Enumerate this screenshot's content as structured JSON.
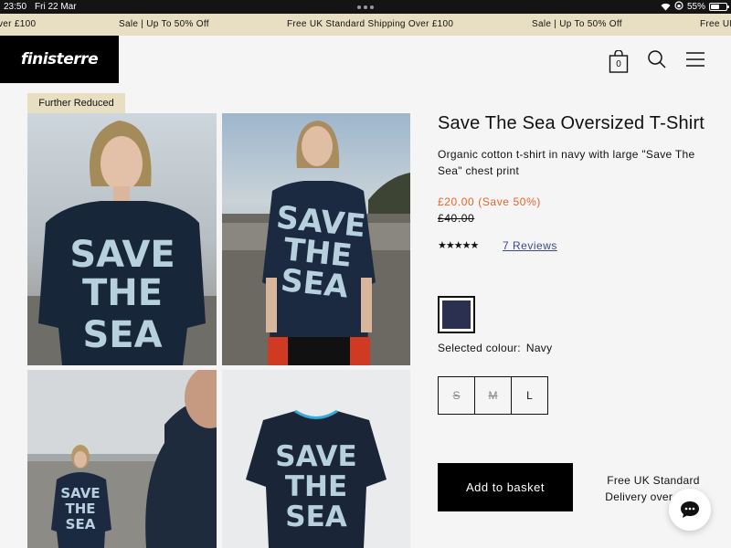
{
  "status_bar": {
    "time": "23:50",
    "date": "Fri 22 Mar",
    "battery": "55%"
  },
  "promo": {
    "items": [
      "ver £100",
      "Sale | Up To 50% Off",
      "Free UK Standard Shipping Over £100",
      "Sale | Up To 50% Off",
      "Free UK"
    ]
  },
  "header": {
    "logo": "finisterre",
    "bag_count": "0",
    "icons": [
      "bag-icon",
      "search-icon",
      "menu-icon"
    ]
  },
  "gallery": {
    "badge": "Further Reduced",
    "print_lines": [
      "SAVE",
      "THE",
      "SEA"
    ]
  },
  "product": {
    "title": "Save The Sea Oversized T-Shirt",
    "description": "Organic cotton t-shirt in navy with large \"Save The Sea\" chest print",
    "price": "£20.00 (Save 50%)",
    "was_price": "£40.00",
    "rating": 5,
    "reviews_label": "7 Reviews",
    "selected_colour_label": "Selected colour:",
    "selected_colour": "Navy",
    "swatch_color": "#2b3050",
    "sizes": [
      {
        "label": "S",
        "available": false
      },
      {
        "label": "M",
        "available": false
      },
      {
        "label": "L",
        "available": true
      }
    ],
    "add_to_basket": "Add to basket",
    "shipping_line1": "Free UK Standard",
    "shipping_line2": "Delivery over £100"
  },
  "colors": {
    "promo_bg": "#e8dfc2",
    "sale_price": "#e8632a",
    "link": "#3a4a8a"
  }
}
